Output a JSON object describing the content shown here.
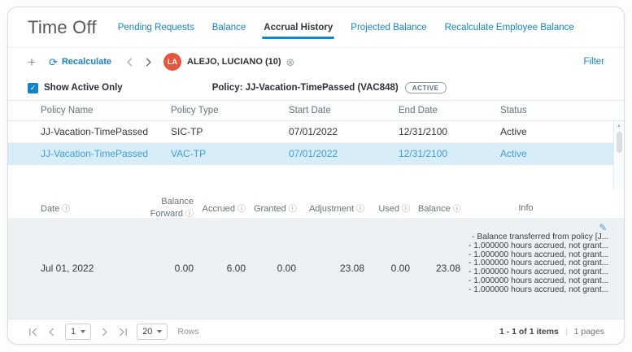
{
  "header": {
    "title": "Time Off",
    "tabs": [
      {
        "label": "Pending Requests"
      },
      {
        "label": "Balance"
      },
      {
        "label": "Accrual History"
      },
      {
        "label": "Projected Balance"
      },
      {
        "label": "Recalculate Employee Balance"
      }
    ]
  },
  "toolbar": {
    "recalculate": "Recalculate",
    "employee_initials": "LA",
    "employee_name": "ALEJO, LUCIANO (10)",
    "filter": "Filter"
  },
  "filter_row": {
    "show_active": "Show Active Only",
    "policy": "Policy: JJ-Vacation-TimePassed (VAC848)",
    "badge": "ACTIVE"
  },
  "policy_table": {
    "columns": [
      "Policy Name",
      "Policy Type",
      "Start Date",
      "End Date",
      "Status"
    ],
    "rows": [
      {
        "policy_name": "JJ-Vacation-TimePassed",
        "policy_type": "SIC-TP",
        "start_date": "07/01/2022",
        "end_date": "12/31/2100",
        "status": "Active",
        "selected": false
      },
      {
        "policy_name": "JJ-Vacation-TimePassed",
        "policy_type": "VAC-TP",
        "start_date": "07/01/2022",
        "end_date": "12/31/2100",
        "status": "Active",
        "selected": true
      }
    ]
  },
  "accrual_table": {
    "columns": [
      "Date",
      "Balance Forward",
      "Accrued",
      "Granted",
      "Adjustment",
      "Used",
      "Balance",
      "Info"
    ],
    "rows": [
      {
        "date": "Jul 01, 2022",
        "balance_forward": "0.00",
        "accrued": "6.00",
        "granted": "0.00",
        "adjustment": "23.08",
        "used": "0.00",
        "balance": "23.08",
        "info_lines": [
          "- Balance transferred from policy [J...",
          "- 1.000000 hours accrued, not grant...",
          "- 1.000000 hours accrued, not grant...",
          "- 1.000000 hours accrued, not grant...",
          "- 1.000000 hours accrued, not grant...",
          "- 1.000000 hours accrued, not grant...",
          "- 1.000000 hours accrued, not grant..."
        ]
      }
    ]
  },
  "pagination": {
    "page": "1",
    "page_size": "20",
    "rows_label": "Rows",
    "items": "1 - 1 of 1 items",
    "sep": "|",
    "pages": "1 pages"
  },
  "icons": {
    "plus": "+",
    "refresh": "⟳",
    "close": "⊗",
    "check": "✓",
    "info": "ⓘ",
    "edit": "✎",
    "scroll_up": "▲"
  },
  "colors": {
    "accent": "#1583c7",
    "selected_row_bg": "#d9edf9",
    "avatar_bg": "#e8563e",
    "accrual_body_bg": "#edf1f4"
  }
}
